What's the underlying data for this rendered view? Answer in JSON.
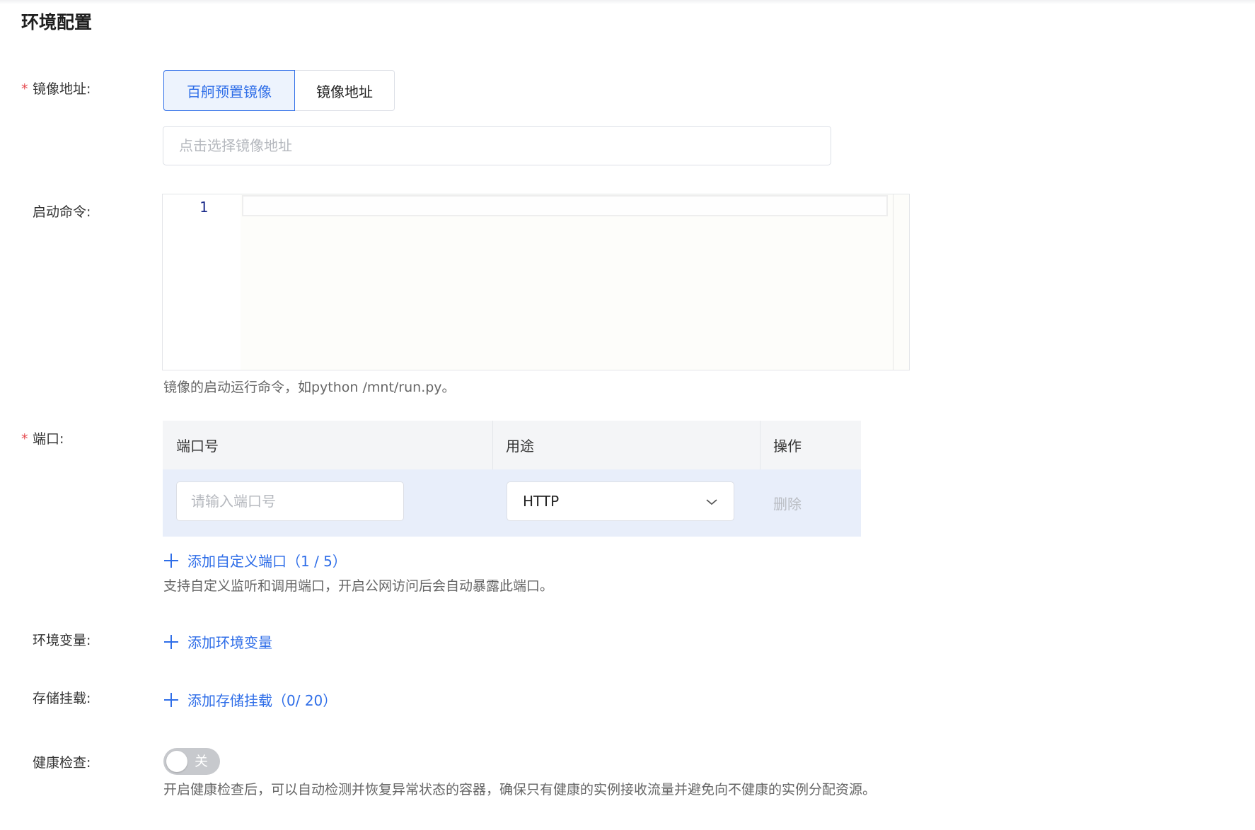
{
  "section": {
    "title": "环境配置"
  },
  "image": {
    "label": "镜像地址:",
    "required_mark": "*",
    "tabs": [
      "百舸预置镜像",
      "镜像地址"
    ],
    "active_tab": 0,
    "placeholder": "点击选择镜像地址",
    "value": ""
  },
  "startup": {
    "label": "启动命令:",
    "line_number": "1",
    "code": "",
    "help": "镜像的启动运行命令，如python /mnt/run.py。"
  },
  "ports": {
    "label": "端口:",
    "required_mark": "*",
    "columns": [
      "端口号",
      "用途",
      "操作"
    ],
    "rows": [
      {
        "port_placeholder": "请输入端口号",
        "port_value": "",
        "usage": "HTTP",
        "action": "删除"
      }
    ],
    "add_label": "添加自定义端口（1 / 5）",
    "help": "支持自定义监听和调用端口，开启公网访问后会自动暴露此端口。"
  },
  "env_vars": {
    "label": "环境变量:",
    "add_label": "添加环境变量"
  },
  "storage": {
    "label": "存储挂载:",
    "add_label": "添加存储挂载（0/ 20）"
  },
  "health": {
    "label": "健康检查:",
    "toggle_state": "off",
    "toggle_text": "关",
    "help": "开启健康检查后，可以自动检测并恢复异常状态的容器，确保只有健康的实例接收流量并避免向不健康的实例分配资源。"
  },
  "colors": {
    "accent": "#2f6ee8",
    "required": "#e5484d",
    "table_header_bg": "#f4f5f7",
    "table_row_bg": "#e8eefa",
    "toggle_off": "#c7c9cd"
  },
  "icons": {
    "select_arrow": "chevron-down-icon",
    "add": "plus-icon"
  }
}
